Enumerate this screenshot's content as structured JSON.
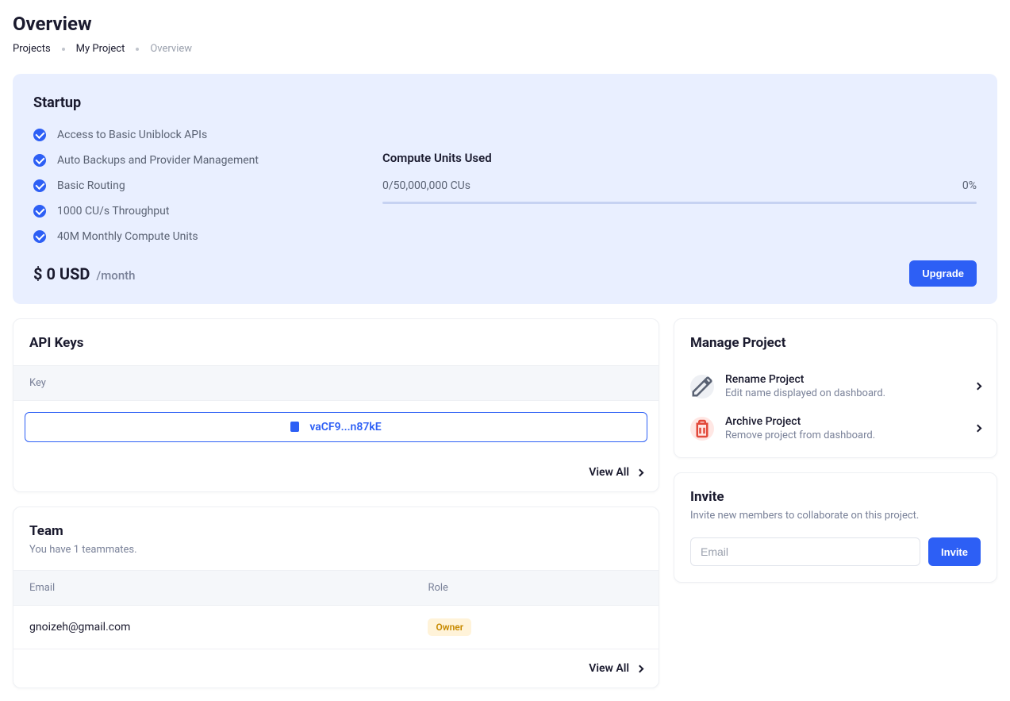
{
  "page": {
    "title": "Overview"
  },
  "breadcrumb": {
    "items": [
      "Projects",
      "My Project"
    ],
    "current": "Overview"
  },
  "plan": {
    "name": "Startup",
    "features": [
      "Access to Basic Uniblock APIs",
      "Auto Backups and Provider Management",
      "Basic Routing",
      "1000 CU/s Throughput",
      "40M Monthly Compute Units"
    ],
    "compute_label": "Compute Units Used",
    "compute_usage": "0/50,000,000 CUs",
    "compute_percent": "0%",
    "price_amount": "$ 0 USD",
    "price_period": "/month",
    "upgrade_label": "Upgrade"
  },
  "api_keys": {
    "title": "API Keys",
    "column_key": "Key",
    "keys": [
      {
        "masked": "vaCF9...n87kE"
      }
    ],
    "view_all_label": "View All"
  },
  "team": {
    "title": "Team",
    "subtitle": "You have 1 teammates.",
    "columns": {
      "email": "Email",
      "role": "Role"
    },
    "members": [
      {
        "email": "gnoizeh@gmail.com",
        "role": "Owner"
      }
    ],
    "view_all_label": "View All"
  },
  "manage": {
    "title": "Manage Project",
    "rename": {
      "title": "Rename Project",
      "sub": "Edit name displayed on dashboard."
    },
    "archive": {
      "title": "Archive Project",
      "sub": "Remove project from dashboard."
    }
  },
  "invite": {
    "title": "Invite",
    "subtitle": "Invite new members to collaborate on this project.",
    "placeholder": "Email",
    "button_label": "Invite"
  }
}
